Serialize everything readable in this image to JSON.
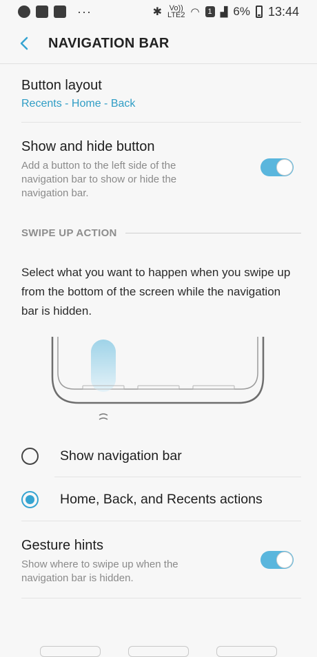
{
  "status_bar": {
    "dots": "···",
    "network": "LTE2",
    "volte": "Vo))",
    "sim": "1",
    "battery": "6%",
    "time": "13:44"
  },
  "header": {
    "title": "NAVIGATION BAR"
  },
  "button_layout": {
    "title": "Button layout",
    "value": "Recents - Home - Back"
  },
  "show_hide": {
    "title": "Show and hide button",
    "description": "Add a button to the left side of the navigation bar to show or hide the navigation bar.",
    "enabled": true
  },
  "swipe_section": {
    "header": "SWIPE UP ACTION",
    "description": "Select what you want to happen when you swipe up from the bottom of the screen while the navigation bar is hidden."
  },
  "options": [
    {
      "label": "Show navigation bar",
      "selected": false
    },
    {
      "label": "Home, Back, and Recents actions",
      "selected": true
    }
  ],
  "gesture_hints": {
    "title": "Gesture hints",
    "description": "Show where to swipe up when the navigation bar is hidden.",
    "enabled": true
  },
  "colors": {
    "accent": "#36a4d1",
    "toggle_on": "#5ab6dd",
    "subtitle": "#2f9dc5"
  }
}
